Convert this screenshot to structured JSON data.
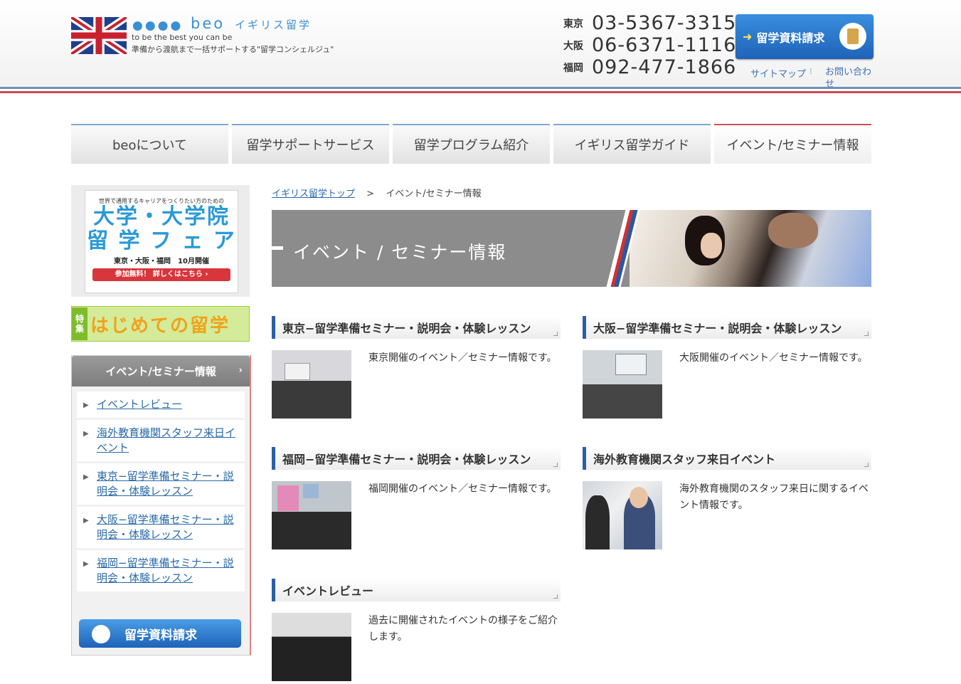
{
  "header": {
    "logo_dots": "●●●●",
    "logo_name": "beo",
    "logo_sub": "イギリス留学",
    "tagline_en": "to be the best you can be",
    "tagline_jp": "準備から渡航まで一括サポートする\"留学コンシェルジュ\"",
    "phones": [
      {
        "city": "東京",
        "number": "03-5367-3315"
      },
      {
        "city": "大阪",
        "number": "06-6371-1116"
      },
      {
        "city": "福岡",
        "number": "092-477-1866"
      }
    ],
    "request_button": "留学資料請求",
    "util_links": {
      "sitemap": "サイトマップ",
      "separator": "⁝",
      "contact": "お問い合わせ"
    }
  },
  "nav": [
    {
      "label": "beoについて",
      "active": false
    },
    {
      "label": "留学サポートサービス",
      "active": false
    },
    {
      "label": "留学プログラム紹介",
      "active": false
    },
    {
      "label": "イギリス留学ガイド",
      "active": false
    },
    {
      "label": "イベント/セミナー情報",
      "active": true
    }
  ],
  "sidebar": {
    "fair_banner": {
      "small": "世界で通用するキャリアをつくりたい方のための",
      "line1": "大学・大学院",
      "line2": "留 学 フ ェ ア",
      "locations": "東京・大阪・福岡　10月開催",
      "button": "参加無料！ 詳しくはこちら ›"
    },
    "hajimete": {
      "tag": "特集",
      "text": "はじめての留学"
    },
    "nav_title": "イベント/セミナー情報",
    "nav_chevron": "›",
    "items": [
      {
        "label": "イベントレビュー"
      },
      {
        "label": "海外教育機関スタッフ来日イベント"
      },
      {
        "label": "東京−留学準備セミナー・説明会・体験レッスン"
      },
      {
        "label": "大阪−留学準備セミナー・説明会・体験レッスン"
      },
      {
        "label": "福岡−留学準備セミナー・説明会・体験レッスン"
      }
    ],
    "request_label": "留学資料請求"
  },
  "breadcrumb": {
    "home": "イギリス留学トップ",
    "separator": ">",
    "current": "イベント/セミナー情報"
  },
  "hero": {
    "title": "イベント / セミナー情報"
  },
  "sections": [
    {
      "title": "東京−留学準備セミナー・説明会・体験レッスン",
      "text": "東京開催のイベント／セミナー情報です。"
    },
    {
      "title": "大阪−留学準備セミナー・説明会・体験レッスン",
      "text": "大阪開催のイベント／セミナー情報です。"
    },
    {
      "title": "福岡−留学準備セミナー・説明会・体験レッスン",
      "text": "福岡開催のイベント／セミナー情報です。"
    },
    {
      "title": "海外教育機関スタッフ来日イベント",
      "text": "海外教育機関のスタッフ来日に関するイベント情報です。"
    },
    {
      "title": "イベントレビュー",
      "text": "過去に開催されたイベントの様子をご紹介します。"
    }
  ],
  "colors": {
    "brand_blue": "#3a8fd6",
    "accent_red": "#cc5057",
    "section_bar": "#2a5fa5"
  }
}
